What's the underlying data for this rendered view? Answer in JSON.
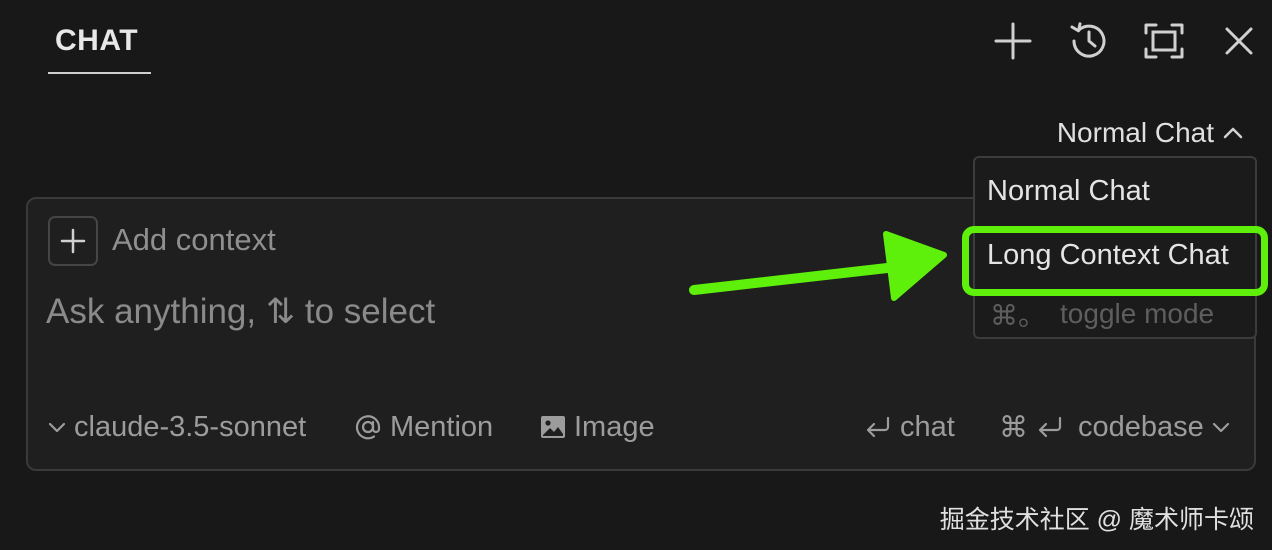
{
  "header": {
    "tab_label": "CHAT"
  },
  "mode_selector": {
    "label": "Normal Chat"
  },
  "mode_menu": {
    "items": [
      "Normal Chat",
      "Long Context Chat"
    ],
    "hint_key": "⌘。",
    "hint_text": "toggle mode",
    "highlighted_item": "Long Context Chat"
  },
  "composer": {
    "add_context_label": "Add context",
    "placeholder": "Ask anything, ⇅ to select",
    "value": "",
    "model": "claude-3.5-sonnet",
    "mention_label": "Mention",
    "image_label": "Image",
    "chat_label": "chat",
    "codebase_key": "⌘",
    "codebase_label": "codebase"
  },
  "icons": {
    "new_chat": "plus-icon",
    "history": "history-icon",
    "maximize": "maximize-icon",
    "close": "close-icon"
  },
  "colors": {
    "background": "#181818",
    "panel_border": "#3a3a3a",
    "annotation": "#5ef00a"
  },
  "watermark": "掘金技术社区 @ 魔术师卡颂"
}
